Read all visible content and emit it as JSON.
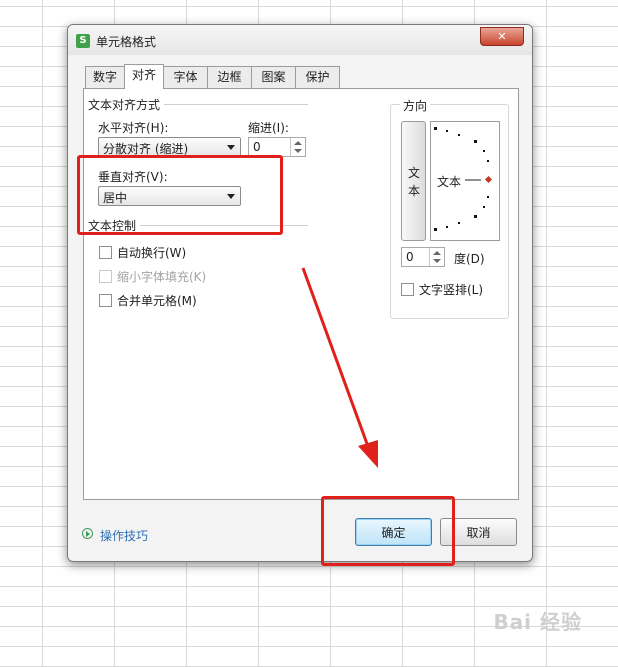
{
  "window": {
    "title": "单元格格式",
    "app_icon_glyph": "S",
    "close_glyph": "✕"
  },
  "tabs": [
    {
      "label": "数字",
      "active": false
    },
    {
      "label": "对齐",
      "active": true
    },
    {
      "label": "字体",
      "active": false
    },
    {
      "label": "边框",
      "active": false
    },
    {
      "label": "图案",
      "active": false
    },
    {
      "label": "保护",
      "active": false
    }
  ],
  "alignment": {
    "section_label": "文本对齐方式",
    "horizontal_label": "水平对齐(H):",
    "horizontal_value": "分散对齐 (缩进)",
    "indent_label": "缩进(I):",
    "indent_value": "0",
    "vertical_label": "垂直对齐(V):",
    "vertical_value": "居中"
  },
  "text_control": {
    "section_label": "文本控制",
    "wrap_text": {
      "label": "自动换行(W)",
      "checked": false,
      "enabled": true
    },
    "shrink_to_fit": {
      "label": "缩小字体填充(K)",
      "checked": false,
      "enabled": false
    },
    "merge_cells": {
      "label": "合并单元格(M)",
      "checked": false,
      "enabled": true
    }
  },
  "orientation": {
    "section_label": "方向",
    "vertical_text_chars": [
      "文",
      "本"
    ],
    "dial_text": "文本",
    "degree_value": "0",
    "degree_label": "度(D)",
    "vertical_stack_label": "文字竖排(L)"
  },
  "footer": {
    "tips_link": "操作技巧",
    "ok_button": "确定",
    "cancel_button": "取消"
  },
  "watermark": "Bai 经验",
  "colors": {
    "annotation_red": "#e0211b",
    "help_green": "#3d9a5a",
    "link_blue": "#2f6fb5",
    "close_red": "#c9432c",
    "dial_marker": "#c0392b"
  }
}
